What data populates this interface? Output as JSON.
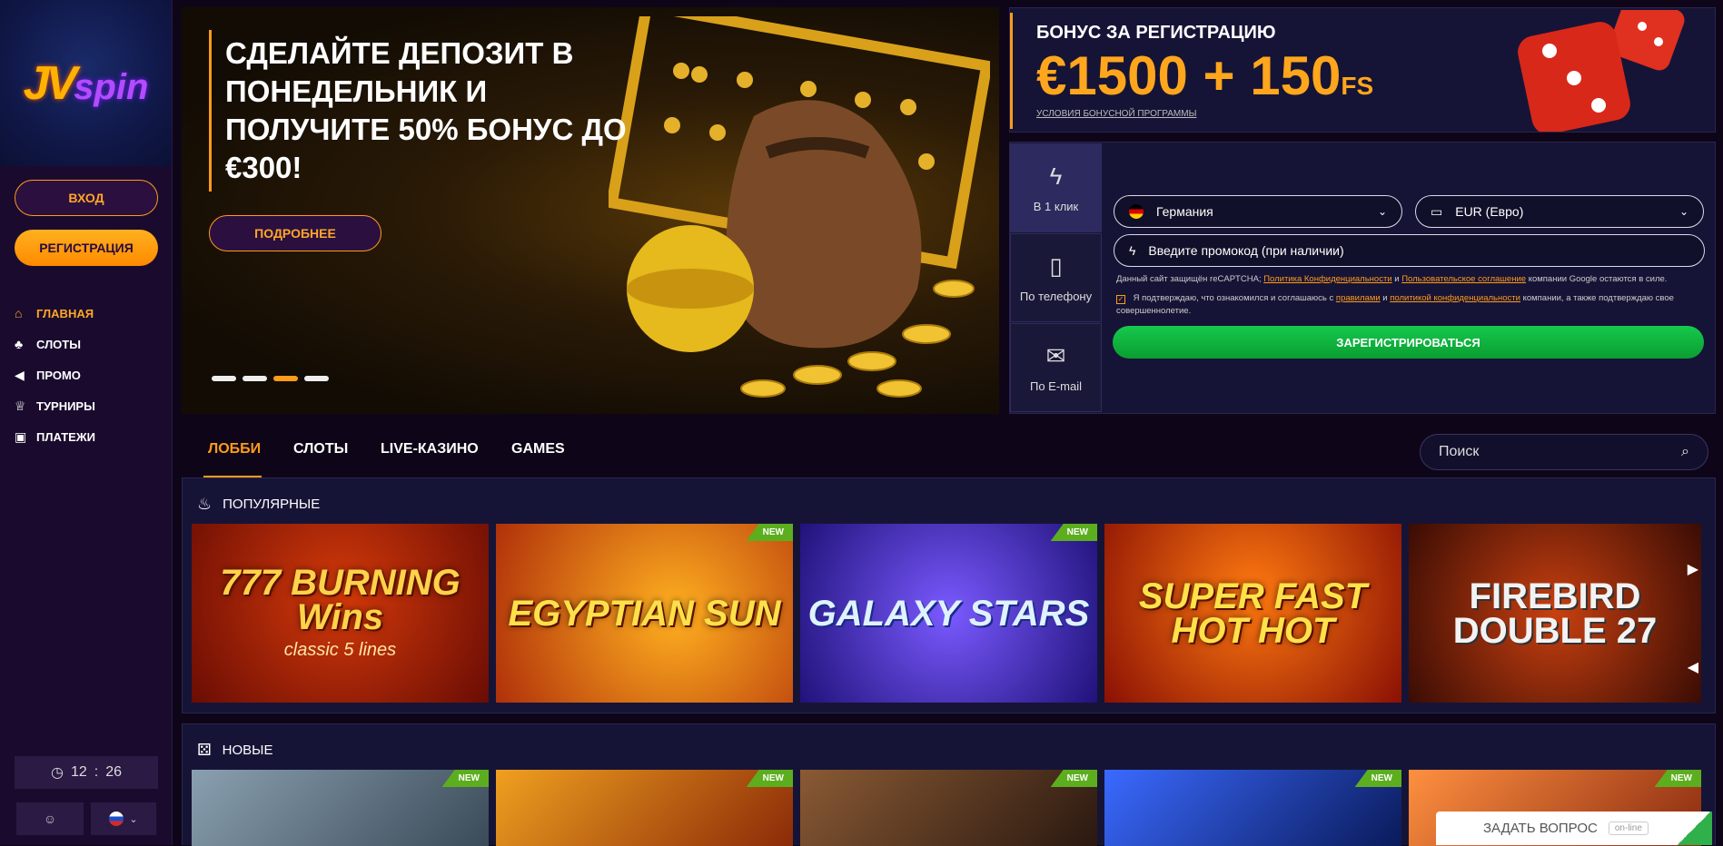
{
  "sidebar": {
    "logo_text": "JV",
    "logo_sub": "spin",
    "login_label": "ВХОД",
    "register_label": "РЕГИСТРАЦИЯ",
    "items": [
      {
        "label": "ГЛАВНАЯ",
        "icon": "home-icon",
        "glyph": "⌂",
        "active": true
      },
      {
        "label": "СЛОТЫ",
        "icon": "cherries-icon",
        "glyph": "♣"
      },
      {
        "label": "ПРОМО",
        "icon": "megaphone-icon",
        "glyph": "◀"
      },
      {
        "label": "ТУРНИРЫ",
        "icon": "trophy-icon",
        "glyph": "♕"
      },
      {
        "label": "ПЛАТЕЖИ",
        "icon": "wallet-icon",
        "glyph": "▣"
      }
    ],
    "clock_hours": "12",
    "clock_minutes": "26",
    "lang": "RU"
  },
  "hero": {
    "title": "СДЕЛАЙТЕ ДЕПОЗИТ В ПОНЕДЕЛЬНИК И ПОЛУЧИТЕ 50% БОНУС ДО €300!",
    "button_label": "ПОДРОБНЕЕ",
    "slides_count": 4,
    "active_slide": 3
  },
  "bonus": {
    "title": "БОНУС ЗА РЕГИСТРАЦИЮ",
    "amount": "€1500 + 150",
    "amount_suffix": "FS",
    "link_label": "УСЛОВИЯ БОНУСНОЙ ПРОГРАММЫ"
  },
  "registration": {
    "tabs": [
      {
        "label": "В 1 клик",
        "icon": "lightning-icon",
        "glyph": "ϟ"
      },
      {
        "label": "По телефону",
        "icon": "phone-icon",
        "glyph": "▯"
      },
      {
        "label": "По E-mail",
        "icon": "envelope-icon",
        "glyph": "✉"
      }
    ],
    "country_value": "Германия",
    "currency_value": "EUR (Евро)",
    "promo_placeholder": "Введите промокод (при наличии)",
    "recaptcha_text_1": "Данный сайт защищён reCAPTCHA;",
    "recaptcha_link_1": "Политика Конфиденциальности",
    "recaptcha_and": "и",
    "recaptcha_link_2": "Пользовательское соглашение",
    "recaptcha_text_2": "компании Google остаются в силе.",
    "confirm_text_1": "Я подтверждаю, что ознакомился и соглашаюсь с",
    "confirm_link_1": "правилами",
    "confirm_and": "и",
    "confirm_link_2": "политикой конфиденциальности",
    "confirm_text_2": "компании, а также подтверждаю свое совершеннолетие.",
    "submit_label": "ЗАРЕГИСТРИРОВАТЬСЯ"
  },
  "lobby_tabs": [
    {
      "label": "ЛОББИ",
      "active": true
    },
    {
      "label": "СЛОТЫ"
    },
    {
      "label": "LIVE-КАЗИНО"
    },
    {
      "label": "GAMES"
    }
  ],
  "search": {
    "placeholder": "Поиск"
  },
  "sections": {
    "popular": {
      "title": "ПОПУЛЯРНЫЕ",
      "icon": "fire-icon",
      "games": [
        {
          "name": "777 BURNING Wins",
          "sub": "classic 5 lines",
          "new": false,
          "bg": "#8a1206"
        },
        {
          "name": "EGYPTIAN SUN",
          "sub": "",
          "new": true,
          "bg": "#c43a06"
        },
        {
          "name": "GALAXY STARS",
          "sub": "",
          "new": true,
          "bg": "#3a2a9a"
        },
        {
          "name": "SUPER FAST HOT HOT",
          "sub": "",
          "new": false,
          "bg": "#b02208"
        },
        {
          "name": "FIREBIRD DOUBLE 27",
          "sub": "",
          "new": false,
          "bg": "#6a1a06"
        }
      ]
    },
    "new": {
      "title": "НОВЫЕ",
      "icon": "dice-icon",
      "games": [
        {
          "new": true,
          "bg": "#4a6070"
        },
        {
          "new": true,
          "bg": "#a04a10"
        },
        {
          "new": true,
          "bg": "#5a3a24"
        },
        {
          "new": true,
          "bg": "#1a3a8a"
        },
        {
          "new": true,
          "bg": "#c06020"
        }
      ]
    }
  },
  "badge_label": "NEW",
  "ask": {
    "label": "ЗАДАТЬ ВОПРОС",
    "status": "on-line"
  },
  "colors": {
    "accent": "#ff9b1a",
    "panel": "#161436",
    "success": "#16c94c",
    "new_badge": "#5cae1e"
  }
}
